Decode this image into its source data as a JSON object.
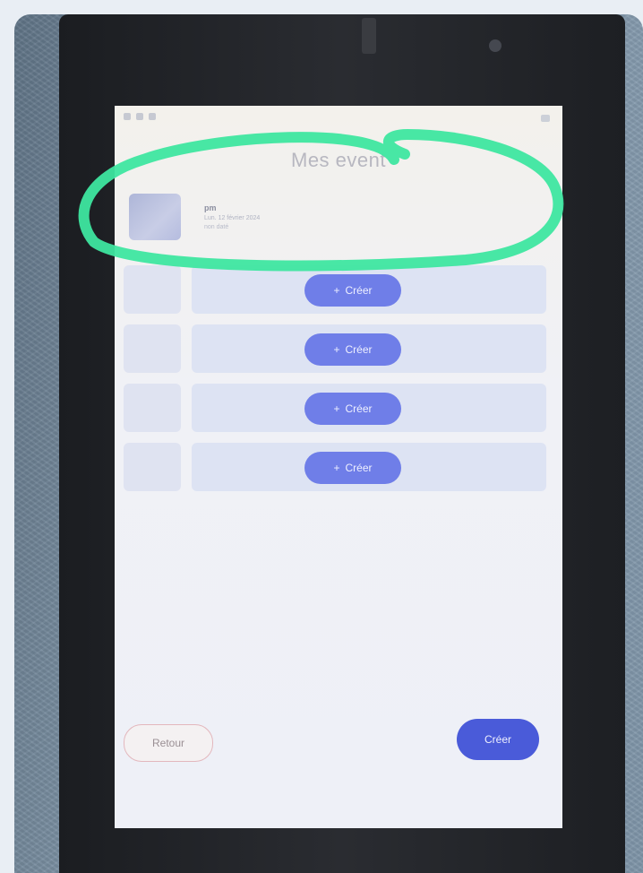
{
  "screen": {
    "title": "Mes event",
    "event": {
      "name": "pm",
      "date": "Lun. 12 février 2024",
      "subtitle": "non daté"
    },
    "slots": [
      {
        "button_label": "Créer"
      },
      {
        "button_label": "Créer"
      },
      {
        "button_label": "Créer"
      },
      {
        "button_label": "Créer"
      }
    ],
    "footer": {
      "back_label": "Retour",
      "create_label": "Créer"
    }
  },
  "icons": {
    "plus": "+"
  },
  "colors": {
    "primary": "#4a5bd9",
    "primary_light": "#6f7ee8",
    "highlight": "#3ee6a0",
    "back_border": "#e3b7bd"
  }
}
